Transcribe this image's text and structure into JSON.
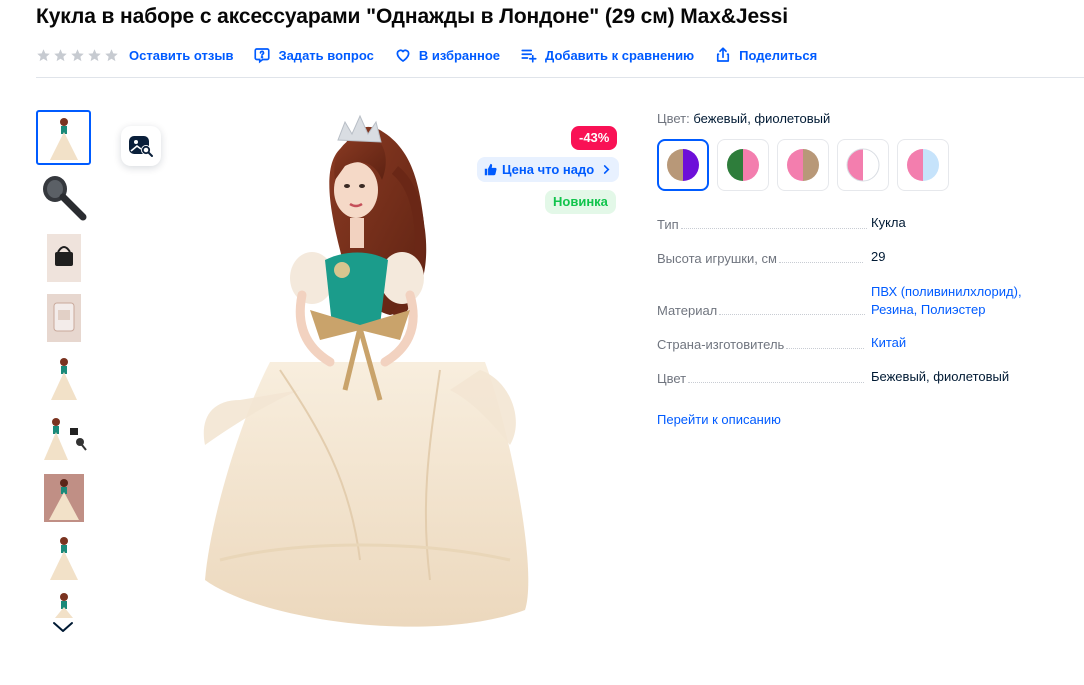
{
  "product": {
    "title": "Кукла в наборе с аксессуарами \"Однажды в Лондоне\" (29 см) Max&Jessi"
  },
  "actions": {
    "rating_stars": 0,
    "review": "Оставить отзыв",
    "question": "Задать вопрос",
    "favorite": "В избранное",
    "compare": "Добавить к сравнению",
    "share": "Поделиться"
  },
  "gallery": {
    "thumbnails": [
      {
        "icon": "doll-dress-image"
      },
      {
        "icon": "hairbrush-image"
      },
      {
        "icon": "handbag-image"
      },
      {
        "icon": "mirror-image"
      },
      {
        "icon": "doll-dress-image"
      },
      {
        "icon": "doll-accessories-image"
      },
      {
        "icon": "doll-dress-image"
      },
      {
        "icon": "doll-dress-image"
      },
      {
        "icon": "doll-dress-image"
      }
    ]
  },
  "badges": {
    "discount": "-43%",
    "price_label": "Цена что надо",
    "new_label": "Новинка"
  },
  "colors": {
    "label": "Цвет:",
    "value": "бежевый, фиолетовый",
    "swatches": [
      {
        "left": "#b89878",
        "right": "#6d0fd9"
      },
      {
        "left": "#2e7d3b",
        "right": "#f37eae"
      },
      {
        "left": "#f37eae",
        "right": "#b89878"
      },
      {
        "left": "#f37eae",
        "right": "#ffffff"
      },
      {
        "left": "#f37eae",
        "right": "#c6e3fb"
      }
    ]
  },
  "properties": [
    {
      "key": "Тип",
      "value": "Кукла",
      "link": false
    },
    {
      "key": "Высота игрушки, см",
      "value": "29",
      "link": false
    },
    {
      "key": "Материал",
      "value": "ПВХ (поливинилхлорид),",
      "value2": "Резина, Полиэстер",
      "link": true
    },
    {
      "key": "Страна-изготовитель",
      "value": "Китай",
      "link": true
    },
    {
      "key": "Цвет",
      "value": "Бежевый, фиолетовый",
      "link": false
    }
  ],
  "go_to_description": "Перейти к описанию",
  "theme": {
    "accent": "#005bff",
    "discount": "#f91155",
    "new": "#10c44c"
  }
}
